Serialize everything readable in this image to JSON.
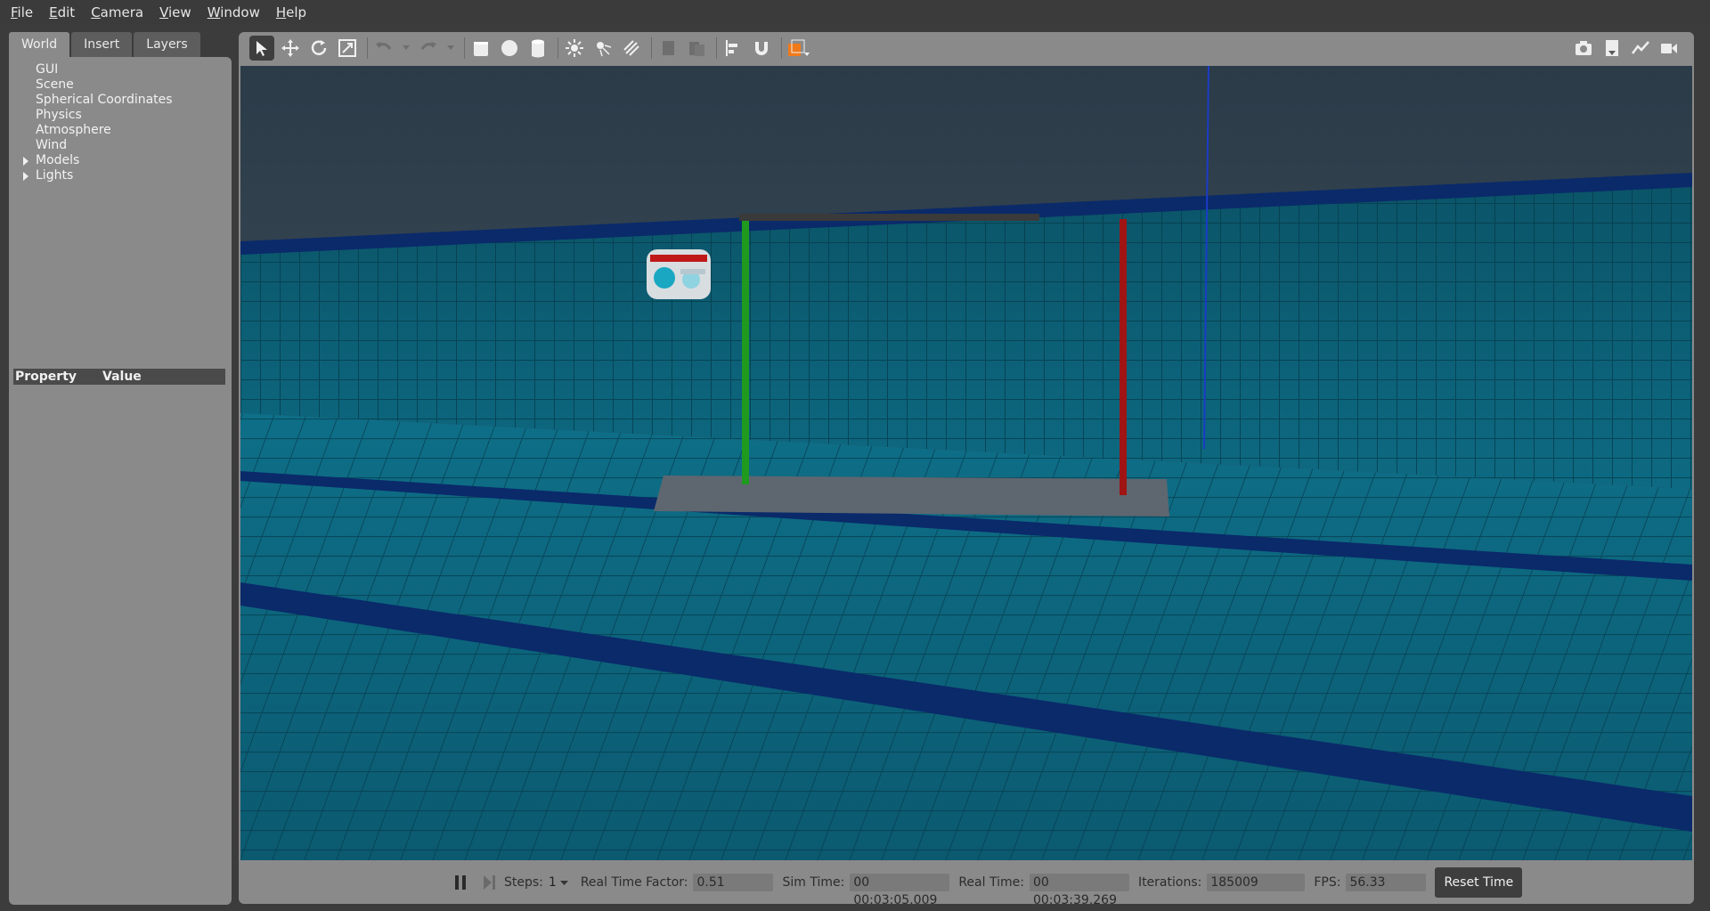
{
  "menu": [
    {
      "label": "File",
      "accel": "F",
      "rest": "ile"
    },
    {
      "label": "Edit",
      "accel": "E",
      "rest": "dit"
    },
    {
      "label": "Camera",
      "accel": "C",
      "rest": "amera"
    },
    {
      "label": "View",
      "accel": "V",
      "rest": "iew"
    },
    {
      "label": "Window",
      "accel": "W",
      "rest": "indow"
    },
    {
      "label": "Help",
      "accel": "H",
      "rest": "elp"
    }
  ],
  "tabs": {
    "world": "World",
    "insert": "Insert",
    "layers": "Layers"
  },
  "tree": {
    "gui": "GUI",
    "scene": "Scene",
    "spherical": "Spherical Coordinates",
    "physics": "Physics",
    "atmosphere": "Atmosphere",
    "wind": "Wind",
    "models": "Models",
    "lights": "Lights"
  },
  "properties": {
    "col_property": "Property",
    "col_value": "Value"
  },
  "bottom": {
    "steps_label": "Steps:",
    "steps_value": "1",
    "rtf_label": "Real Time Factor:",
    "rtf_value": "0.51",
    "sim_label": "Sim Time:",
    "sim_value": "00 00:03:05.009",
    "real_label": "Real Time:",
    "real_value": "00 00:03:39.269",
    "iter_label": "Iterations:",
    "iter_value": "185009",
    "fps_label": "FPS:",
    "fps_value": "56.33",
    "reset_label": "Reset Time"
  },
  "colors": {
    "water": "#0e6a82",
    "lane": "#0a2a6a",
    "gate_left": "#1f9a1f",
    "gate_right": "#a01414",
    "gate_top": "#3a3a3a"
  }
}
